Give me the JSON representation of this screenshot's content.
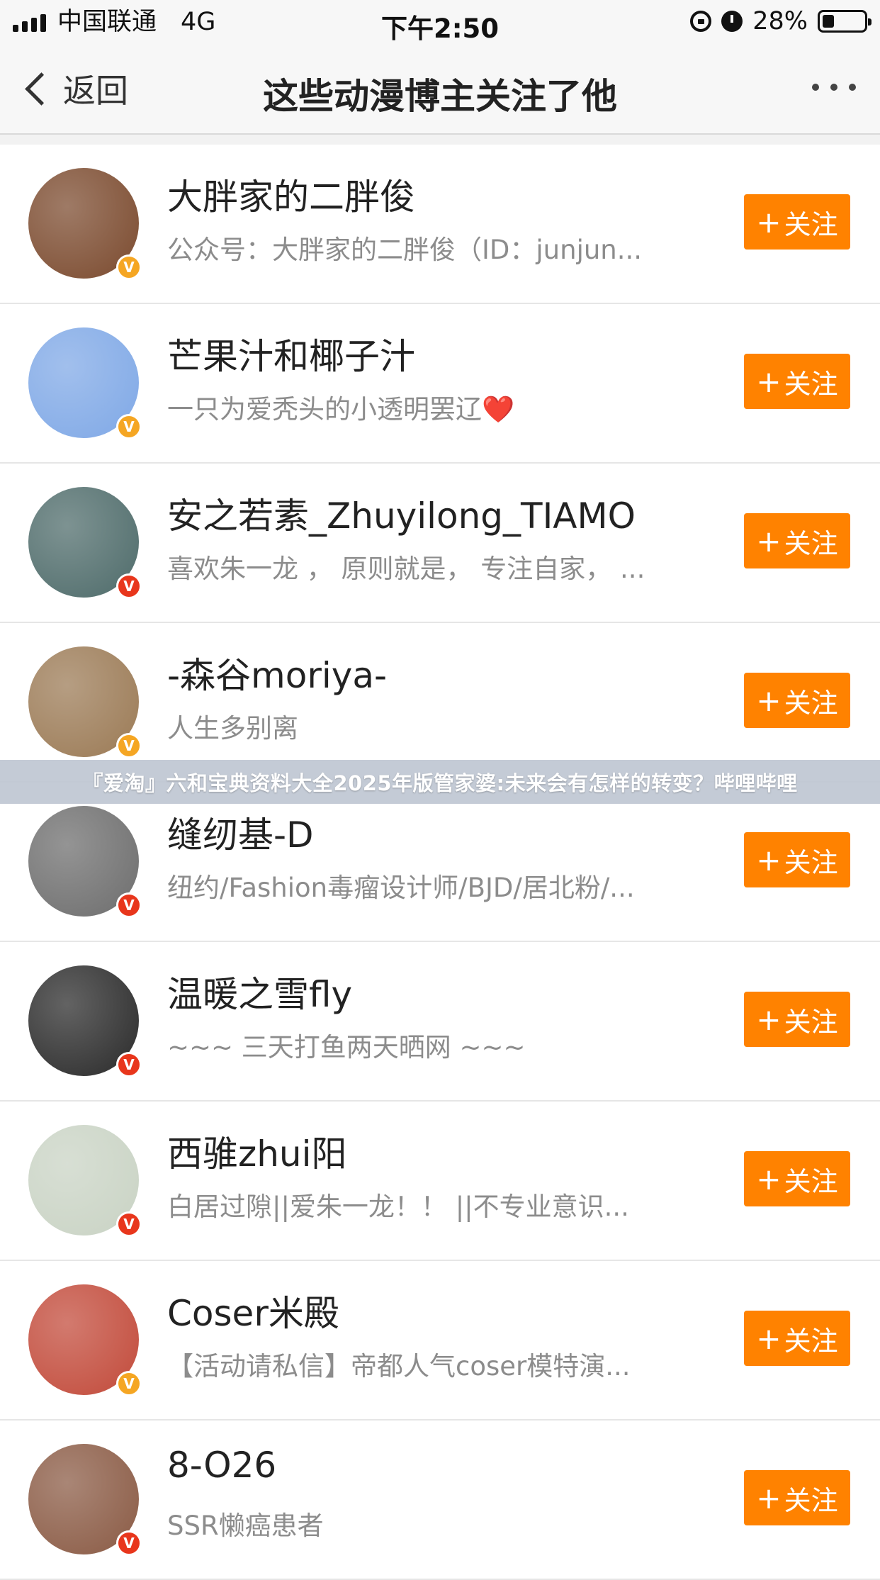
{
  "status_bar": {
    "carrier": "中国联通",
    "network": "4G",
    "time": "下午2:50",
    "battery": "28%",
    "battery_level": 0.28
  },
  "nav": {
    "back_label": "返回",
    "title": "这些动漫博主关注了他"
  },
  "follow_label": "关注",
  "follow_plus": "+",
  "colors": {
    "accent": "#ff8200",
    "badge_gold": "#f5a623",
    "badge_red": "#e8361c",
    "name": "#222222",
    "desc": "#8c8c8c"
  },
  "users": [
    {
      "name": "大胖家的二胖俊",
      "desc": "公众号：大胖家的二胖俊（ID：junjun...",
      "badge": "gold",
      "avatar_color": "#7b4a2e",
      "avatar_icon": "cartoon-boy-with-glasses"
    },
    {
      "name": "芒果汁和椰子汁",
      "desc": "一只为爱秃头的小透明罢辽❤️",
      "badge": "gold",
      "avatar_color": "#7fa8e6",
      "avatar_icon": "text-logo-xiang-shou-sheng-huo"
    },
    {
      "name": "安之若素_Zhuyilong_TIAMO",
      "desc": "喜欢朱一龙 ，  原则就是，  专注自家，  ...",
      "badge": "red",
      "avatar_color": "#4e6b6a",
      "avatar_icon": "chibi-character-seal"
    },
    {
      "name": "-森谷moriya-",
      "desc": "人生多别离",
      "badge": "gold",
      "avatar_color": "#9b7a55",
      "avatar_icon": "cat-photo"
    },
    {
      "name": "缝纫基-D",
      "desc": "纽约/Fashion毒瘤设计师/BJD/居北粉/...",
      "badge": "red",
      "avatar_color": "#6d6d6d",
      "avatar_icon": "manga-sketch-face"
    },
    {
      "name": "温暖之雪fly",
      "desc": "~~~ 三天打鱼两天晒网 ~~~",
      "badge": "red",
      "avatar_color": "#2a2a2a",
      "avatar_icon": "cartoon-cat-face"
    },
    {
      "name": "西骓zhui阳",
      "desc": "白居过隙||爱朱一龙！！ ||不专业意识...",
      "badge": "red",
      "avatar_color": "#c9d3c4",
      "avatar_icon": "ink-painting-figure"
    },
    {
      "name": "Coser米殿",
      "desc": "【活动请私信】帝都人气coser模特演...",
      "badge": "gold",
      "avatar_color": "#c24a3a",
      "avatar_icon": "cosplay-portrait"
    },
    {
      "name": "8-O26",
      "desc": "SSR懒癌患者",
      "badge": "red",
      "avatar_color": "#8a5a44",
      "avatar_icon": "anime-girl-portrait"
    }
  ],
  "banner": {
    "text": "『爱淘』六和宝典资料大全2025年版管家婆:未来会有怎样的转变？哔哩哔哩"
  }
}
